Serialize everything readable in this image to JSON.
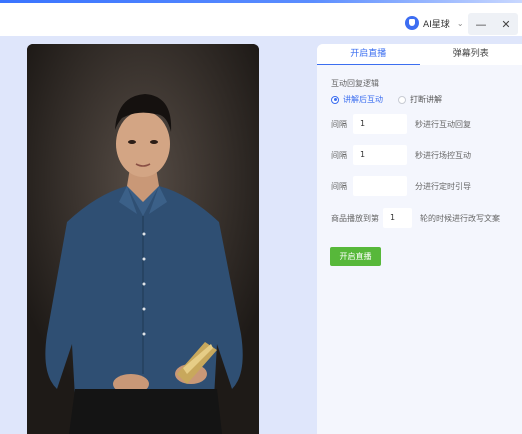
{
  "window": {
    "app_name": "AI星球",
    "brand_chevron": "⌄",
    "minimize_glyph": "—",
    "close_glyph": "✕"
  },
  "tabs": [
    {
      "label": "开启直播",
      "active": true
    },
    {
      "label": "弹幕列表",
      "active": false
    }
  ],
  "reply_logic": {
    "section_label": "互动回复逻辑",
    "options": [
      {
        "label": "讲解后互动",
        "checked": true
      },
      {
        "label": "打断讲解",
        "checked": false
      }
    ]
  },
  "settings": {
    "row1": {
      "prefix": "间隔",
      "value": "1",
      "suffix": "秒进行互动回复"
    },
    "row2": {
      "prefix": "间隔",
      "value": "1",
      "suffix": "秒进行场控互动"
    },
    "row3": {
      "prefix": "间隔",
      "value": "",
      "suffix": "分进行定时引导"
    },
    "row4": {
      "prefix": "商品播放到第",
      "value": "1",
      "suffix": "轮的时候进行改写文案"
    }
  },
  "start_button_label": "开启直播",
  "colors": {
    "accent": "#3b6ef0",
    "start_button": "#57b83a",
    "background": "#dfe6fb"
  }
}
